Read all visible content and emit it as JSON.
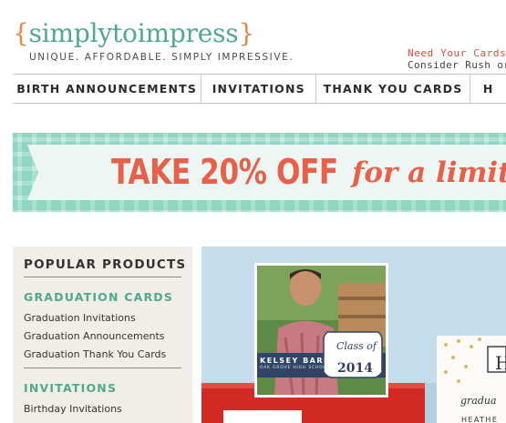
{
  "brand": {
    "brace_open": "{",
    "name": "simplytoimpress",
    "brace_close": "}",
    "tagline": "UNIQUE. AFFORDABLE. SIMPLY IMPRESSIVE."
  },
  "promo": {
    "line1": "Need Your Cards",
    "line2": "Consider Rush or"
  },
  "nav": {
    "items": [
      "BIRTH ANNOUNCEMENTS",
      "INVITATIONS",
      "THANK YOU CARDS",
      "H"
    ]
  },
  "banner": {
    "headline": "TAKE 20% OFF",
    "script": "for a limited"
  },
  "sidebar": {
    "title": "POPULAR PRODUCTS",
    "categories": [
      {
        "title": "GRADUATION CARDS",
        "links": [
          "Graduation Invitations",
          "Graduation Announcements",
          "Graduation Thank You Cards"
        ]
      },
      {
        "title": "INVITATIONS",
        "links": [
          "Birthday Invitations"
        ]
      }
    ]
  },
  "hero": {
    "card1": {
      "name": "KELSEY BARNES",
      "school": "OAK GROVE HIGH SCHOOL",
      "class_of": "Class of",
      "year": "2014"
    },
    "card2": {
      "letter": "H",
      "script": "gradua",
      "name": "HEATHE"
    }
  },
  "colors": {
    "accent_green": "#4fa98c",
    "accent_orange": "#e8864a",
    "banner_red": "#e8604a",
    "promo_red": "#e04b3a",
    "sidebar_bg": "#f1eee8",
    "hero_bg": "#c4dcec"
  }
}
